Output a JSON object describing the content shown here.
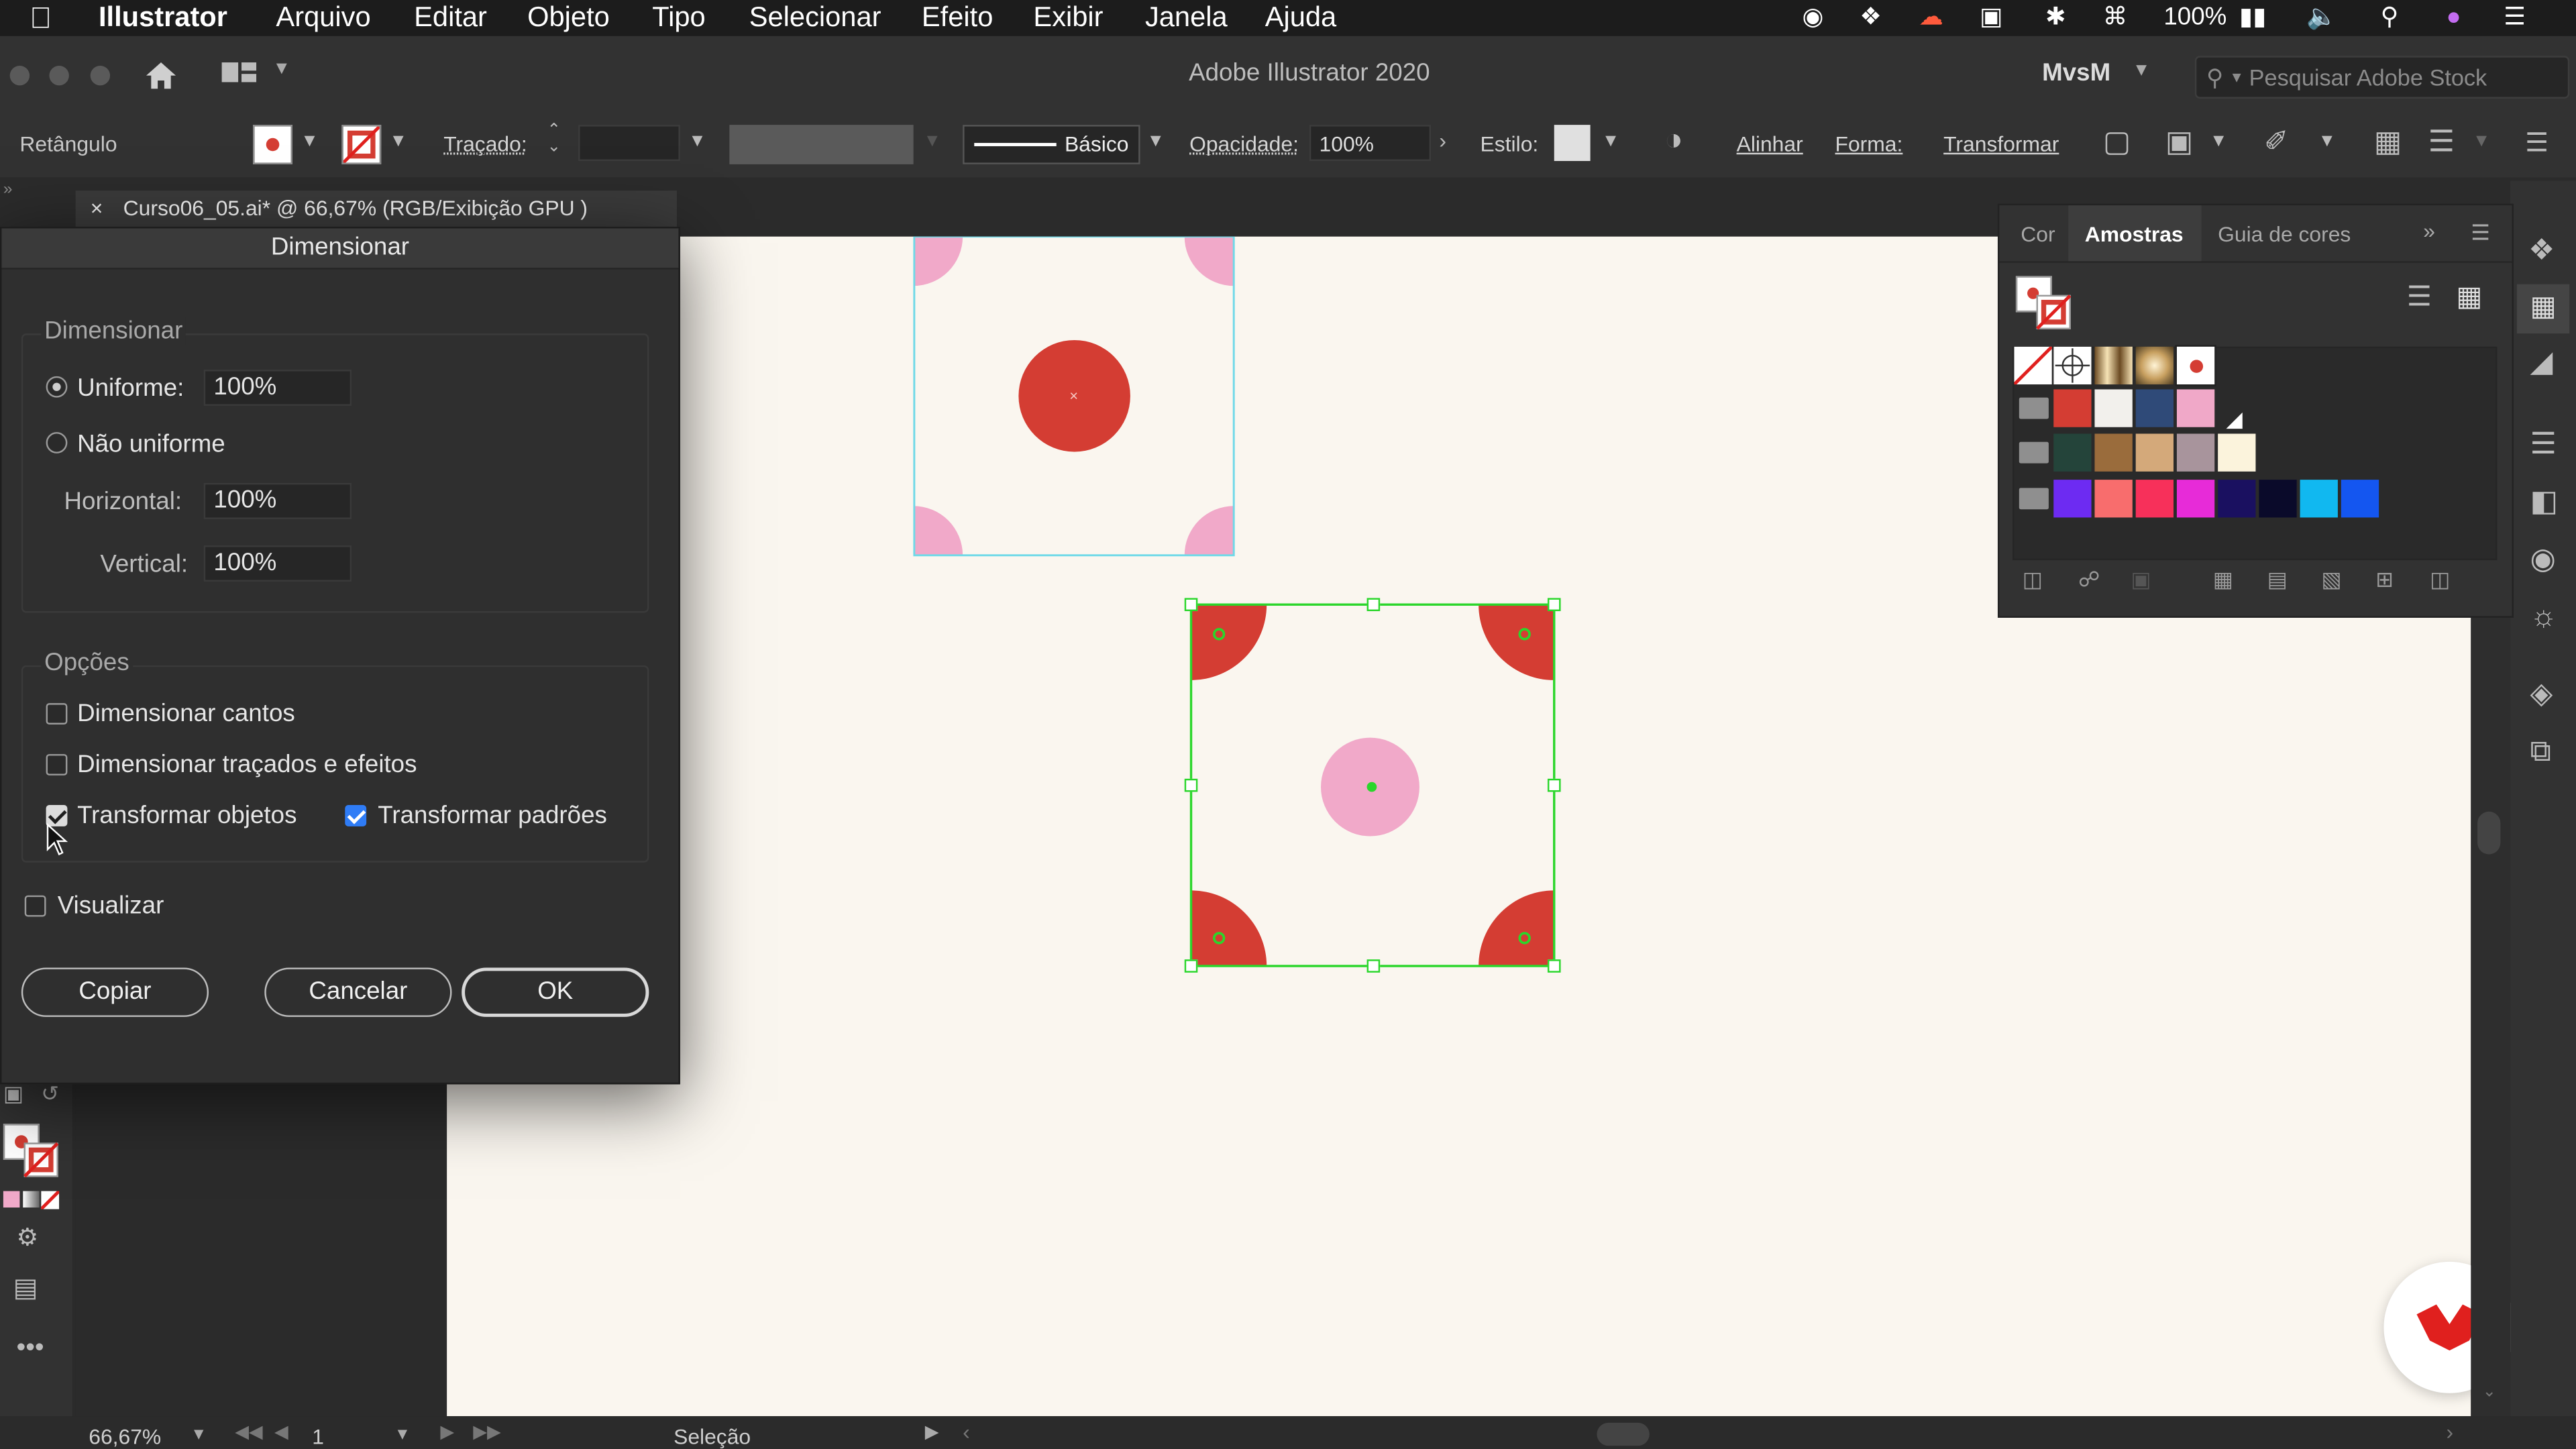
{
  "menubar": {
    "app_name": "Illustrator",
    "items": [
      "Arquivo",
      "Editar",
      "Objeto",
      "Tipo",
      "Selecionar",
      "Efeito",
      "Exibir",
      "Janela",
      "Ajuda"
    ],
    "battery": "100%"
  },
  "titlebar": {
    "title": "Adobe Illustrator 2020",
    "workspace": "MvsM",
    "stock_placeholder": "Pesquisar Adobe Stock"
  },
  "control_bar": {
    "selection_type": "Retângulo",
    "stroke_label": "Traçado:",
    "brush_label": "Básico",
    "opacity_label": "Opacidade:",
    "opacity_value": "100%",
    "style_label": "Estilo:",
    "align_label": "Alinhar",
    "shape_label": "Forma:",
    "transform_label": "Transformar"
  },
  "document_tab": {
    "close_glyph": "×",
    "title": "Curso06_05.ai* @ 66,67% (RGB/Exibição GPU )"
  },
  "dialog": {
    "title": "Dimensionar",
    "scale_group_label": "Dimensionar",
    "uniform_label": "Uniforme:",
    "uniform_value": "100%",
    "uniform_selected": true,
    "non_uniform_label": "Não uniforme",
    "horizontal_label": "Horizontal:",
    "horizontal_value": "100%",
    "vertical_label": "Vertical:",
    "vertical_value": "100%",
    "options_label": "Opções",
    "scale_corners_label": "Dimensionar cantos",
    "scale_corners_checked": false,
    "scale_strokes_label": "Dimensionar traçados e efeitos",
    "scale_strokes_checked": false,
    "transform_objects_label": "Transformar objetos",
    "transform_objects_checked": true,
    "transform_patterns_label": "Transformar padrões",
    "transform_patterns_checked": true,
    "preview_label": "Visualizar",
    "preview_checked": false,
    "copy_button": "Copiar",
    "cancel_button": "Cancelar",
    "ok_button": "OK"
  },
  "swatches_panel": {
    "tabs": [
      "Cor",
      "Amostras",
      "Guia de cores"
    ],
    "active_tab": "Amostras",
    "row1": [
      "none",
      "registration",
      "gradient-gold",
      "gradient-radial",
      "dot-pattern"
    ],
    "row2": [
      "#d43d33",
      "#f2f0ec",
      "#2f4a78",
      "#f0a8c8"
    ],
    "row3": [
      "#24443a",
      "#9a6c3c",
      "#d4a97a",
      "#a8949c",
      "#fbf3dc"
    ],
    "row4": [
      "#6d2bf2",
      "#f86d6d",
      "#f7305a",
      "#e72bd8",
      "#1a1060",
      "#0a0a2a",
      "#11b8f0",
      "#1456f0"
    ]
  },
  "canvas": {
    "artboard_color": "#faf6ef",
    "accent_red": "#d43d33",
    "accent_pink": "#f1a9c9",
    "selection_color": "#2bd62b"
  },
  "statusbar": {
    "zoom": "66,67%",
    "artboard_number": "1",
    "tool": "Seleção"
  }
}
